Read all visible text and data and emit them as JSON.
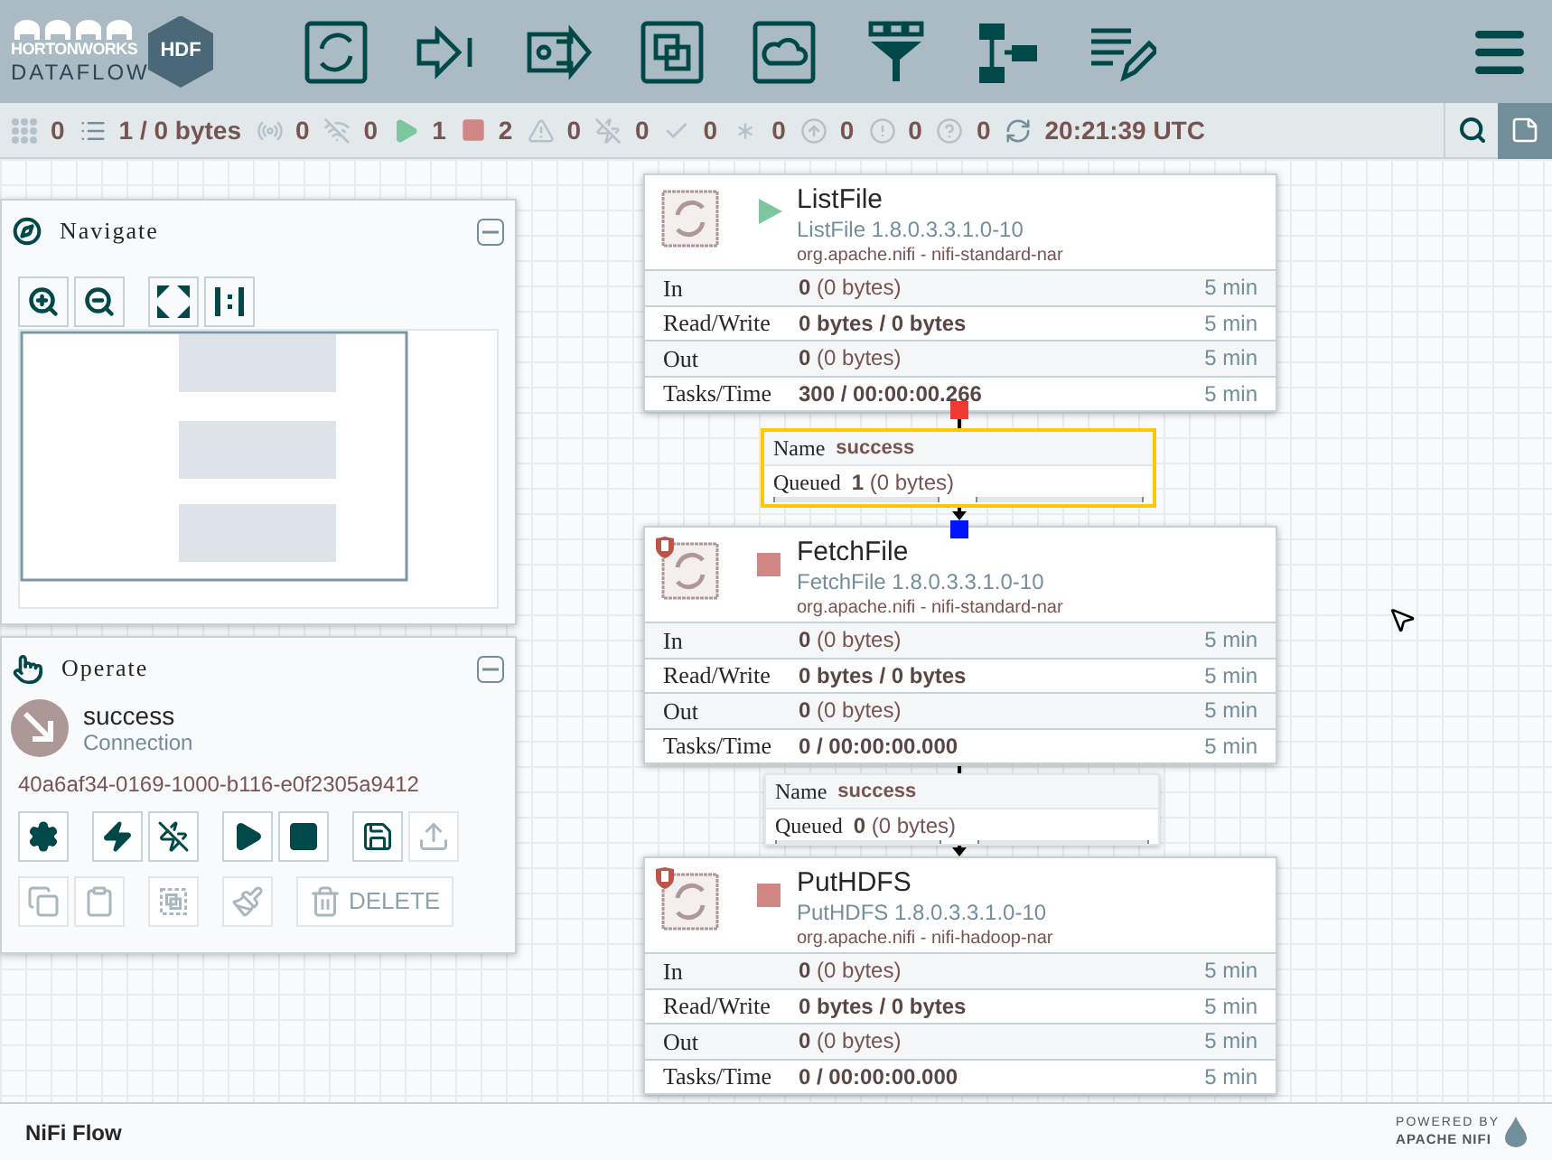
{
  "header": {
    "brand": "HORTONWORKS",
    "product": "DATAFLOW",
    "badge": "HDF"
  },
  "status_bar": {
    "items": [
      {
        "kind": "cluster",
        "value": "0"
      },
      {
        "kind": "queued",
        "value": "1 / 0 bytes"
      },
      {
        "kind": "transmitting",
        "value": "0"
      },
      {
        "kind": "not-transmitting",
        "value": "0"
      },
      {
        "kind": "running",
        "value": "1"
      },
      {
        "kind": "stopped",
        "value": "2"
      },
      {
        "kind": "invalid",
        "value": "0"
      },
      {
        "kind": "disabled",
        "value": "0"
      },
      {
        "kind": "up-to-date",
        "value": "0"
      },
      {
        "kind": "modified",
        "value": "0"
      },
      {
        "kind": "stale",
        "value": "0"
      },
      {
        "kind": "sync-failure",
        "value": "0"
      },
      {
        "kind": "unknown",
        "value": "0"
      },
      {
        "kind": "refresh",
        "value": "20:21:39 UTC"
      }
    ]
  },
  "navigate": {
    "title": "Navigate"
  },
  "operate": {
    "title": "Operate",
    "selection": {
      "name": "success",
      "type": "Connection",
      "id": "40a6af34-0169-1000-b116-e0f2305a9412"
    },
    "buttons": [
      {
        "kind": "configure",
        "disabled": false
      },
      {
        "kind": "enable",
        "disabled": false
      },
      {
        "kind": "disable",
        "disabled": false
      },
      {
        "kind": "start",
        "disabled": false
      },
      {
        "kind": "stop",
        "disabled": false
      },
      {
        "kind": "create-template",
        "disabled": false
      },
      {
        "kind": "upload-template",
        "disabled": true
      },
      {
        "kind": "copy",
        "disabled": true
      },
      {
        "kind": "paste",
        "disabled": true
      },
      {
        "kind": "group",
        "disabled": true
      },
      {
        "kind": "color",
        "disabled": true
      },
      {
        "kind": "delete",
        "label": "DELETE",
        "disabled": true
      }
    ]
  },
  "processors": [
    {
      "name": "ListFile",
      "type": "ListFile 1.8.0.3.3.1.0-10",
      "bundle": "org.apache.nifi - nifi-standard-nar",
      "running": true,
      "restricted": false,
      "stats": [
        {
          "label": "In",
          "value": "0",
          "detail": "(0 bytes)",
          "window": "5 min"
        },
        {
          "label": "Read/Write",
          "value": "0 bytes / 0 bytes",
          "window": "5 min"
        },
        {
          "label": "Out",
          "value": "0",
          "detail": "(0 bytes)",
          "window": "5 min"
        },
        {
          "label": "Tasks/Time",
          "value": "300 / 00:00:00.266",
          "window": "5 min"
        }
      ]
    },
    {
      "name": "FetchFile",
      "type": "FetchFile 1.8.0.3.3.1.0-10",
      "bundle": "org.apache.nifi - nifi-standard-nar",
      "running": false,
      "restricted": true,
      "stats": [
        {
          "label": "In",
          "value": "0",
          "detail": "(0 bytes)",
          "window": "5 min"
        },
        {
          "label": "Read/Write",
          "value": "0 bytes / 0 bytes",
          "window": "5 min"
        },
        {
          "label": "Out",
          "value": "0",
          "detail": "(0 bytes)",
          "window": "5 min"
        },
        {
          "label": "Tasks/Time",
          "value": "0 / 00:00:00.000",
          "window": "5 min"
        }
      ]
    },
    {
      "name": "PutHDFS",
      "type": "PutHDFS 1.8.0.3.3.1.0-10",
      "bundle": "org.apache.nifi - nifi-hadoop-nar",
      "running": false,
      "restricted": true,
      "stats": [
        {
          "label": "In",
          "value": "0",
          "detail": "(0 bytes)",
          "window": "5 min"
        },
        {
          "label": "Read/Write",
          "value": "0 bytes / 0 bytes",
          "window": "5 min"
        },
        {
          "label": "Out",
          "value": "0",
          "detail": "(0 bytes)",
          "window": "5 min"
        },
        {
          "label": "Tasks/Time",
          "value": "0 / 00:00:00.000",
          "window": "5 min"
        }
      ]
    }
  ],
  "connections": [
    {
      "name_label": "Name",
      "name": "success",
      "queued_label": "Queued",
      "queued": "1",
      "queued_detail": "(0 bytes)",
      "selected": true
    },
    {
      "name_label": "Name",
      "name": "success",
      "queued_label": "Queued",
      "queued": "0",
      "queued_detail": "(0 bytes)",
      "selected": false
    }
  ],
  "footer": {
    "breadcrumb": "NiFi Flow",
    "powered_by": "POWERED BY",
    "product": "APACHE NIFI"
  }
}
